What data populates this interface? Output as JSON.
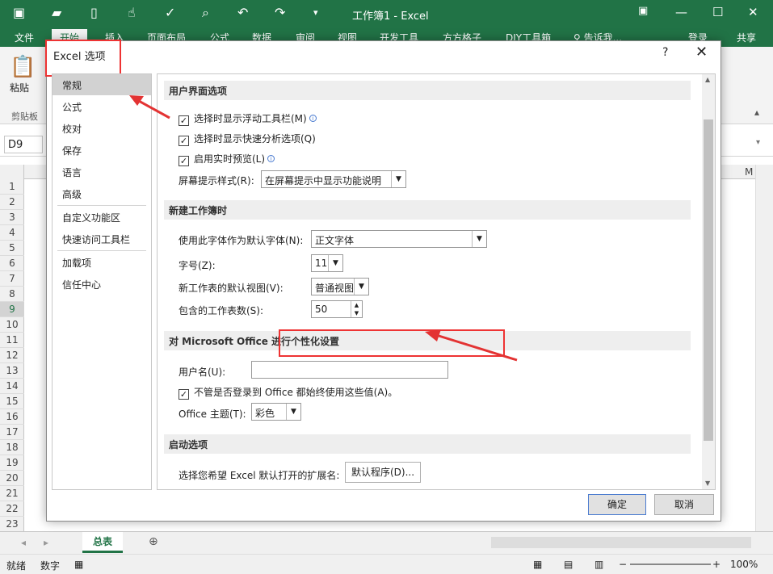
{
  "window": {
    "title": "工作簿1 - Excel",
    "minimize_icon": "minimize-icon",
    "restore_icon": "restore-icon",
    "close_icon": "close-icon"
  },
  "ribbon_tabs": [
    "文件",
    "开始",
    "插入",
    "页面布局",
    "公式",
    "数据",
    "审阅",
    "视图",
    "开发工具",
    "方方格子",
    "DIY工具箱",
    "♀ 告诉我...",
    "登录",
    "共享"
  ],
  "ribbon": {
    "paste_label": "粘贴",
    "clipboard_label": "剪贴板"
  },
  "formula_bar": {
    "name_box": "D9"
  },
  "grid": {
    "col_label_visible": "M",
    "rows": [
      "1",
      "2",
      "3",
      "4",
      "5",
      "6",
      "7",
      "8",
      "9",
      "10",
      "11",
      "12",
      "13",
      "14",
      "15",
      "16",
      "17",
      "18",
      "19",
      "20",
      "21",
      "22",
      "23"
    ],
    "selected_row": "9"
  },
  "sheet_tab": "总表",
  "status_bar": {
    "ready": "就绪",
    "numlock": "数字",
    "zoom": "100%"
  },
  "dialog": {
    "title": "Excel 选项",
    "help": "?",
    "close": "✕",
    "nav": [
      "常规",
      "公式",
      "校对",
      "保存",
      "语言",
      "高级",
      "自定义功能区",
      "快速访问工具栏",
      "加载项",
      "信任中心"
    ],
    "active_nav": "常规",
    "sections": {
      "ui": {
        "title": "用户界面选项",
        "mini_toolbar": "选择时显示浮动工具栏(M)",
        "quick_analysis": "选择时显示快速分析选项(Q)",
        "live_preview": "启用实时预览(L)",
        "tooltip_style_label": "屏幕提示样式(R):",
        "tooltip_style_value": "在屏幕提示中显示功能说明"
      },
      "new_workbook": {
        "title": "新建工作簿时",
        "font_label": "使用此字体作为默认字体(N):",
        "font_value": "正文字体",
        "size_label": "字号(Z):",
        "size_value": "11",
        "view_label": "新工作表的默认视图(V):",
        "view_value": "普通视图",
        "sheets_label": "包含的工作表数(S):",
        "sheets_value": "50"
      },
      "personalize": {
        "title": "对 Microsoft Office 进行个性化设置",
        "username_label": "用户名(U):",
        "username_value": "",
        "always_use": "不管是否登录到 Office 都始终使用这些值(A)。",
        "theme_label": "Office 主题(T):",
        "theme_value": "彩色"
      },
      "startup": {
        "title": "启动选项",
        "extensions_label": "选择您希望 Excel 默认打开的扩展名:",
        "default_programs_button": "默认程序(D)..."
      }
    },
    "ok": "确定",
    "cancel": "取消"
  },
  "colors": {
    "excel_green": "#217346",
    "annotation_red": "#e33333"
  }
}
